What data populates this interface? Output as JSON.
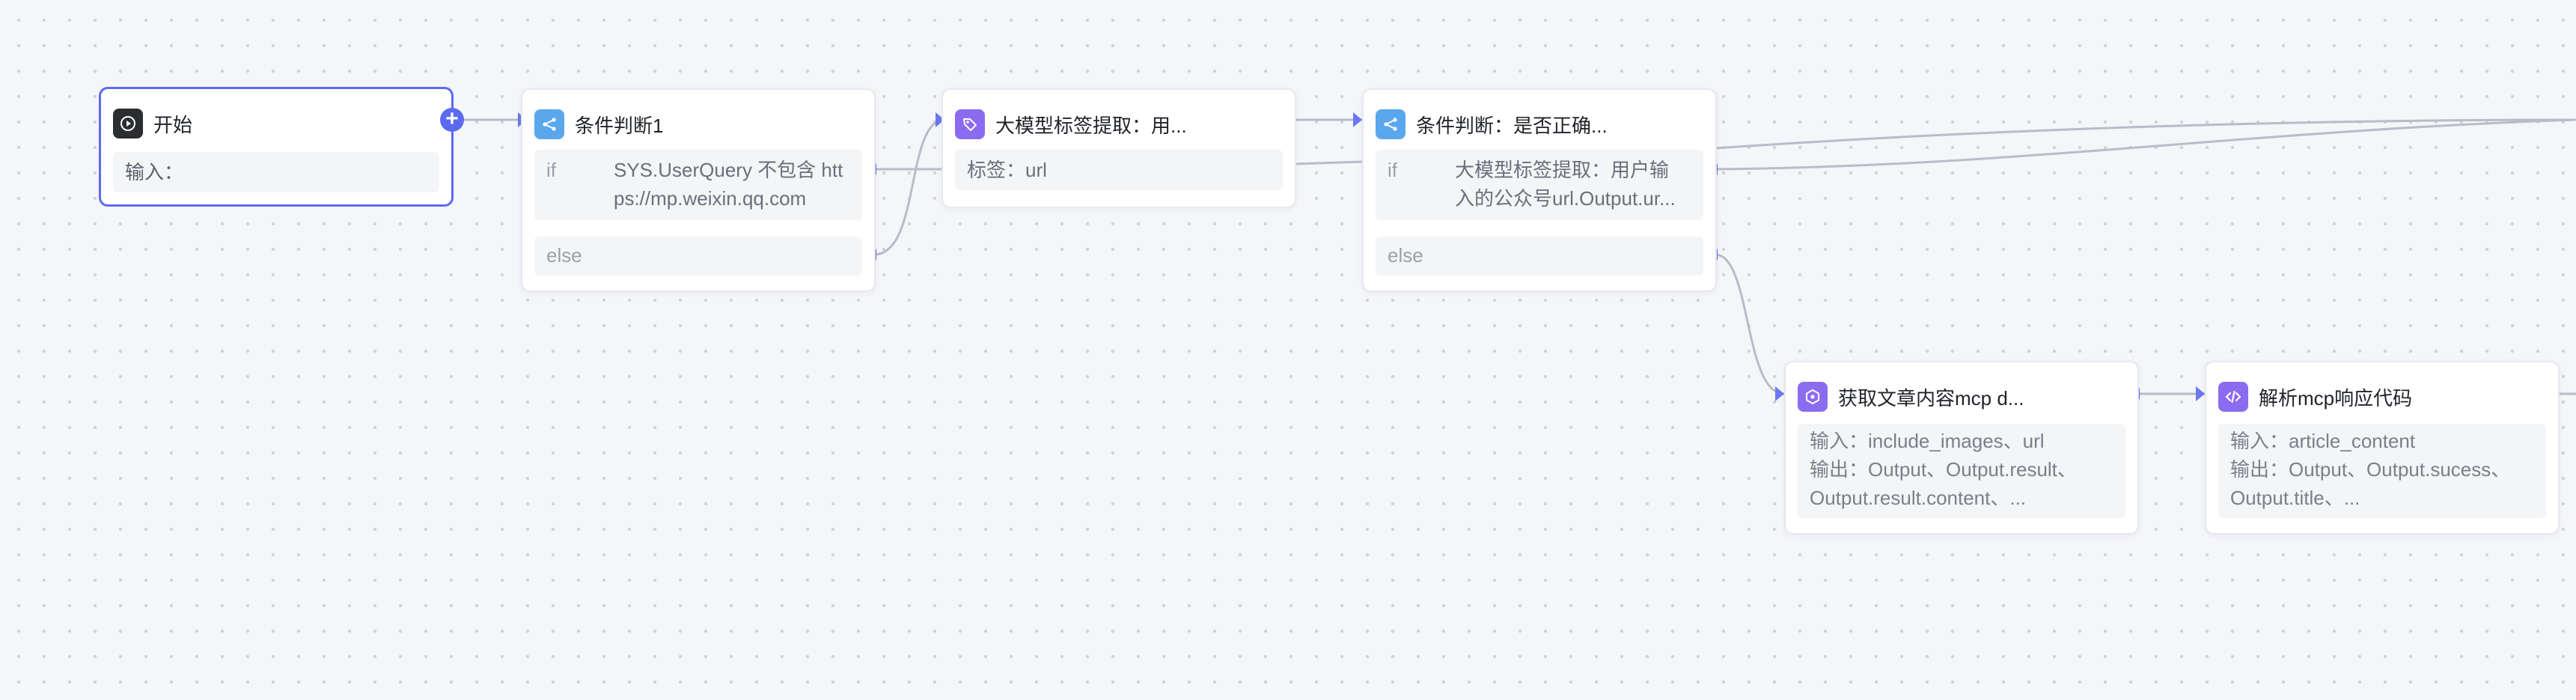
{
  "canvas": {
    "background": "#f5f6f9",
    "accent": "#5b6bf0",
    "edge_color": "#b9bcc8"
  },
  "nodes": {
    "start": {
      "title": "开始",
      "icon": "play-icon",
      "input_label": "输入："
    },
    "cond1": {
      "title": "条件判断1",
      "icon": "branch-icon",
      "if_label": "if",
      "if_condition_line1": "SYS.UserQuery 不包含 htt",
      "if_condition_line2": "ps://mp.weixin.qq.com",
      "else_label": "else"
    },
    "tag_extract": {
      "title": "大模型标签提取：用...",
      "icon": "tag-icon",
      "tag_text": "标签：url"
    },
    "cond2": {
      "title": "条件判断：是否正确...",
      "icon": "branch-icon",
      "if_label": "if",
      "if_condition_line1": "大模型标签提取：用户输",
      "if_condition_line2": "入的公众号url.Output.ur...",
      "else_label": "else"
    },
    "fetch": {
      "title": "获取文章内容mcp d...",
      "icon": "plugin-icon",
      "line1": "输入：include_images、url",
      "line2": "输出：Output、Output.result、",
      "line3": "Output.result.content、..."
    },
    "parse": {
      "title": "解析mcp响应代码",
      "icon": "code-icon",
      "line1": "输入：article_content",
      "line2": "输出：Output、Output.sucess、",
      "line3": "Output.title、..."
    }
  }
}
